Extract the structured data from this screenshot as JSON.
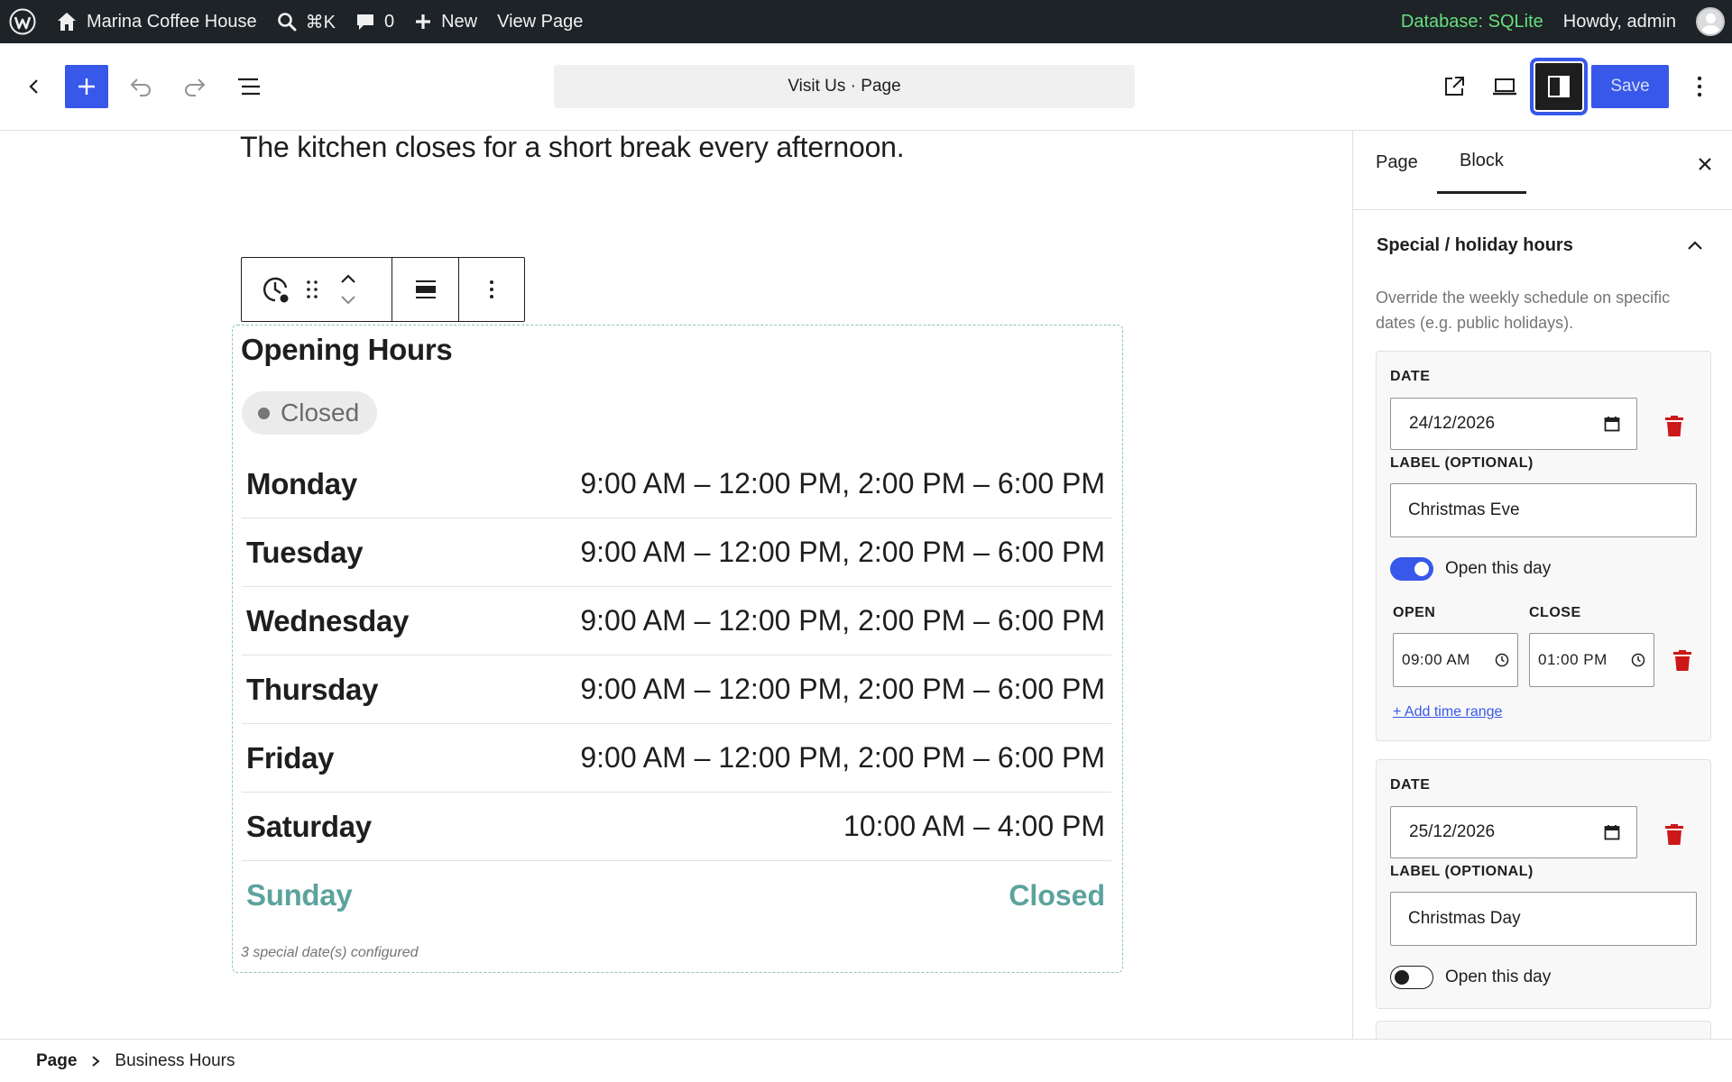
{
  "admin_bar": {
    "site_name": "Marina Coffee House",
    "search_shortcut": "⌘K",
    "comments_count": "0",
    "new_label": "New",
    "view_page_label": "View Page",
    "database_label": "Database: SQLite",
    "howdy_label": "Howdy, admin"
  },
  "header": {
    "document_title": "Visit Us · Page",
    "save_label": "Save"
  },
  "canvas": {
    "intro_text": "The kitchen closes for a short break every afternoon.",
    "block": {
      "title": "Opening Hours",
      "status": "Closed",
      "rows": [
        {
          "day": "Monday",
          "time": "9:00 AM – 12:00 PM, 2:00 PM – 6:00 PM",
          "closed": false
        },
        {
          "day": "Tuesday",
          "time": "9:00 AM – 12:00 PM, 2:00 PM – 6:00 PM",
          "closed": false
        },
        {
          "day": "Wednesday",
          "time": "9:00 AM – 12:00 PM, 2:00 PM – 6:00 PM",
          "closed": false
        },
        {
          "day": "Thursday",
          "time": "9:00 AM – 12:00 PM, 2:00 PM – 6:00 PM",
          "closed": false
        },
        {
          "day": "Friday",
          "time": "9:00 AM – 12:00 PM, 2:00 PM – 6:00 PM",
          "closed": false
        },
        {
          "day": "Saturday",
          "time": "10:00 AM – 4:00 PM",
          "closed": false
        },
        {
          "day": "Sunday",
          "time": "Closed",
          "closed": true
        }
      ],
      "note": "3 special date(s) configured"
    }
  },
  "sidebar": {
    "tabs": [
      {
        "label": "Page",
        "active": false
      },
      {
        "label": "Block",
        "active": true
      }
    ],
    "panel": {
      "title": "Special / holiday hours",
      "description": "Override the weekly schedule on specific dates (e.g. public holidays).",
      "date_label": "DATE",
      "label_label": "LABEL (OPTIONAL)",
      "open_label": "OPEN",
      "close_label": "CLOSE",
      "open_day_label": "Open this day",
      "add_range_label": "+ Add time range",
      "entries": [
        {
          "date": "24/12/2026",
          "label": "Christmas Eve",
          "open_day": true,
          "open_time": "09:00 AM",
          "close_time": "01:00 PM"
        },
        {
          "date": "25/12/2026",
          "label": "Christmas Day",
          "open_day": false
        }
      ]
    }
  },
  "footer": {
    "breadcrumb": [
      "Page",
      "Business Hours"
    ]
  },
  "colors": {
    "admin_bar": "#1d2327",
    "accent": "#3858e9",
    "database_green": "#68de7c",
    "closed_teal": "#5ba39c",
    "trash_red": "#cc1818"
  }
}
